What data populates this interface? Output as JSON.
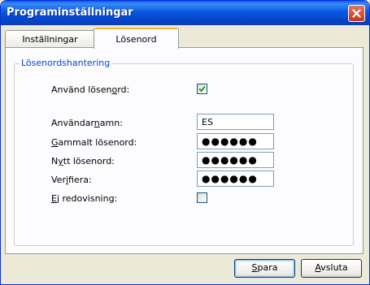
{
  "window": {
    "title": "Programinställningar"
  },
  "tabs": [
    {
      "label": "Inställningar",
      "active": false
    },
    {
      "label": "Lösenord",
      "active": true
    }
  ],
  "group": {
    "legend": "Lösenordshantering"
  },
  "form": {
    "use_password": {
      "pre": "Använd lösen",
      "key": "o",
      "post": "rd:",
      "checked": true
    },
    "username": {
      "pre": "Användar",
      "key": "n",
      "post": "amn:",
      "value": "ES"
    },
    "old_password": {
      "pre": "",
      "key": "G",
      "post": "ammalt lösenord:",
      "value": "●●●●●●"
    },
    "new_password": {
      "pre": "N",
      "key": "y",
      "post": "tt lösenord:",
      "value": "●●●●●●"
    },
    "verify": {
      "pre": "Ver",
      "key": "i",
      "post": "fiera:",
      "value": "●●●●●●"
    },
    "no_reporting": {
      "pre": "",
      "key": "E",
      "post": "j redovisning:",
      "checked": false
    }
  },
  "buttons": {
    "save": {
      "pre": "",
      "key": "S",
      "post": "para"
    },
    "quit": {
      "pre": "",
      "key": "A",
      "post": "vsluta"
    }
  },
  "colors": {
    "titlebar": "#0a58e8",
    "legend": "#0046d5",
    "active_tab_accent": "#f6b53c",
    "checkmark": "#21a121"
  }
}
